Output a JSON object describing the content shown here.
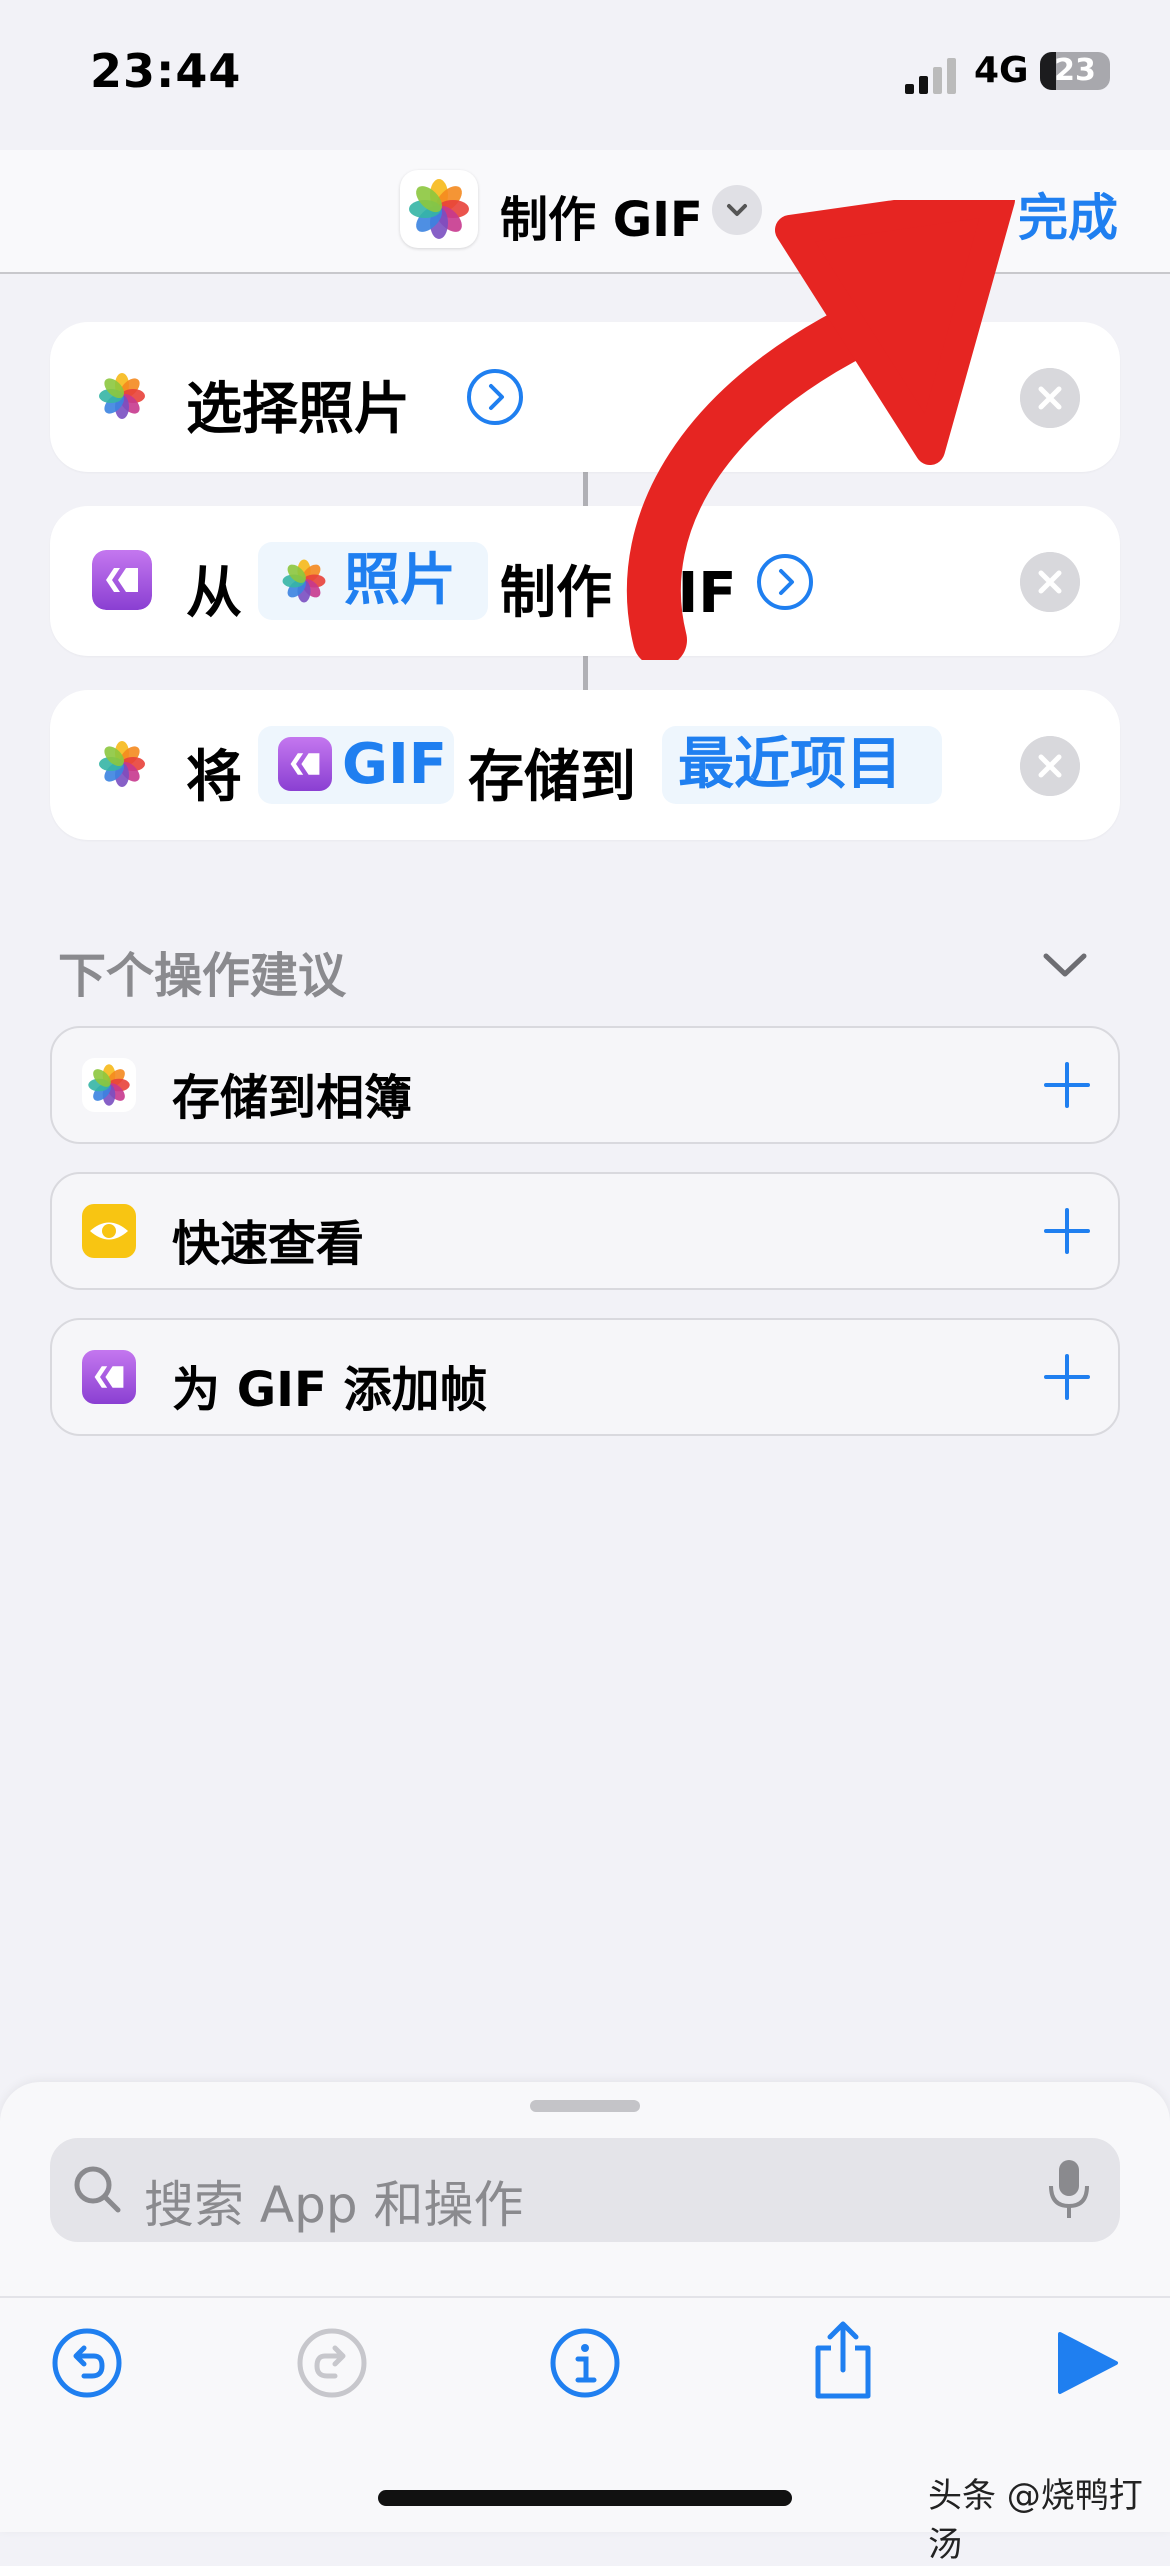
{
  "status": {
    "time": "23:44",
    "network": "4G",
    "battery": "23",
    "battery_level_percent": 23
  },
  "nav": {
    "title": "制作 GIF",
    "done_label": "完成",
    "app_icon": "photos-icon"
  },
  "actions": [
    {
      "icon": "photos-icon",
      "text": "选择照片",
      "has_chevron": true
    },
    {
      "icon": "gif-maker-icon",
      "prefix": "从",
      "token_icon": "photos-icon",
      "token": "照片",
      "suffix": "制作 GIF",
      "has_chevron": true
    },
    {
      "icon": "photos-icon",
      "prefix": "将",
      "token_icon": "gif-maker-icon",
      "token": "GIF",
      "middle": "存储到",
      "token2": "最近项目"
    }
  ],
  "suggestions": {
    "heading": "下个操作建议",
    "items": [
      {
        "icon": "photos-icon",
        "label": "存储到相簿"
      },
      {
        "icon": "quick-look-icon",
        "label": "快速查看"
      },
      {
        "icon": "gif-maker-icon",
        "label": "为 GIF 添加帧"
      }
    ]
  },
  "search": {
    "placeholder": "搜索 App 和操作"
  },
  "toolbar": [
    "undo-icon",
    "redo-icon",
    "info-icon",
    "share-icon",
    "play-icon"
  ],
  "watermark": "头条 @烧鸭打汤",
  "colors": {
    "accent": "#1f7ff0",
    "annotation_arrow": "#e62522",
    "gif_purple": "#a560e0",
    "quicklook_yellow": "#f8c512"
  }
}
